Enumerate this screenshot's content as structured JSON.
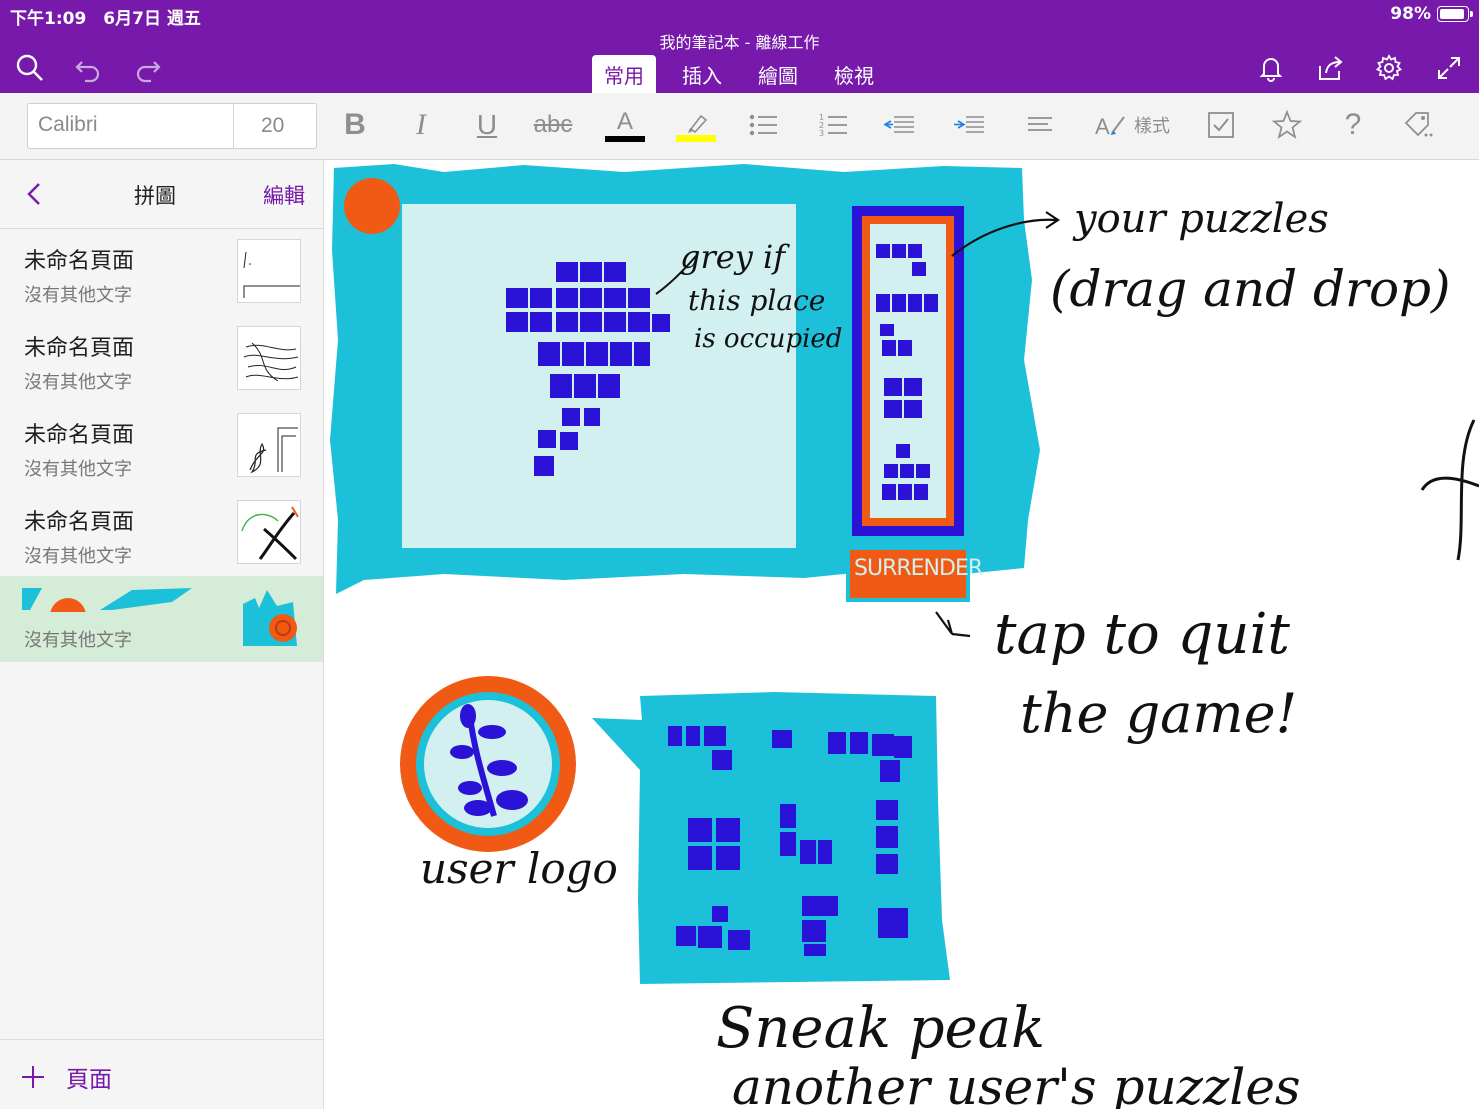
{
  "status_bar": {
    "time": "下午1:09　6月7日 週五",
    "battery": "98%"
  },
  "document_title": "我的筆記本 - 離線工作",
  "tabs": [
    {
      "label": "常用",
      "selected": true
    },
    {
      "label": "插入"
    },
    {
      "label": "繪圖"
    },
    {
      "label": "檢視"
    }
  ],
  "ribbon": {
    "font_name": "Calibri",
    "font_size": "20",
    "bold": "B",
    "italic": "I",
    "underline": "U",
    "strikethrough": "abc",
    "font_color_letter": "A",
    "styles_label": "樣式",
    "help": "?",
    "font_color_hex": "#000000",
    "highlight_hex": "#ffff00"
  },
  "sidebar": {
    "section_title": "拼圖",
    "edit_label": "編輯",
    "pages": [
      {
        "title": "未命名頁面",
        "subtitle": "沒有其他文字"
      },
      {
        "title": "未命名頁面",
        "subtitle": "沒有其他文字"
      },
      {
        "title": "未命名頁面",
        "subtitle": "沒有其他文字"
      },
      {
        "title": "未命名頁面",
        "subtitle": "沒有其他文字"
      },
      {
        "title": "",
        "subtitle": "沒有其他文字",
        "selected": true
      }
    ],
    "add_page_label": "頁面"
  },
  "canvas": {
    "annotations": {
      "grey_if": "grey if",
      "this_place": "this place",
      "is_occupied": "is occupied",
      "your_puzzles": "your puzzles",
      "drag_and_drop": "(drag and drop)",
      "surrender": "SURRENDER",
      "tap_to_quit": "tap to quit",
      "the_game": "the game!",
      "user_logo": "user logo",
      "sneak_peak": "Sneak peak",
      "another_users_puzzles": "another user's puzzles"
    }
  },
  "colors": {
    "accent": "#7719aa",
    "cyan": "#1cc0d9",
    "light_cyan": "#d2f0ef",
    "blue_block": "#2a12d6",
    "orange": "#f05a14",
    "selected_page_bg": "#d5ecd8"
  }
}
